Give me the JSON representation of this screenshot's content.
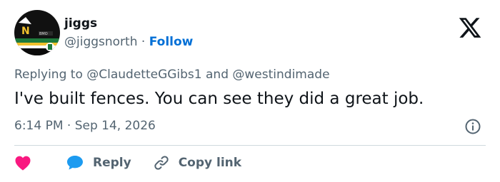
{
  "author": {
    "name": "jiggs",
    "handle": "@jiggsnorth",
    "separator": "·",
    "follow_label": "Follow",
    "avatar_icon": "hockey-jersey-icon"
  },
  "reply_context": {
    "prefix": "Replying to",
    "mention_1": "@ClaudetteGGibs1",
    "conjunction": "and",
    "mention_2": "@westindimade"
  },
  "tweet": {
    "text": "I've built fences. You can see they did a great job.",
    "timestamp": "6:14 PM · Sep 14, 2026"
  },
  "actions": {
    "like_icon": "heart-icon",
    "reply_label": "Reply",
    "copy_link_label": "Copy link"
  },
  "colors": {
    "link_blue": "#006fd6",
    "secondary_text": "#536471",
    "heart_red": "#f91880",
    "reply_blue": "#1d9bf0",
    "text": "#0f1419"
  }
}
